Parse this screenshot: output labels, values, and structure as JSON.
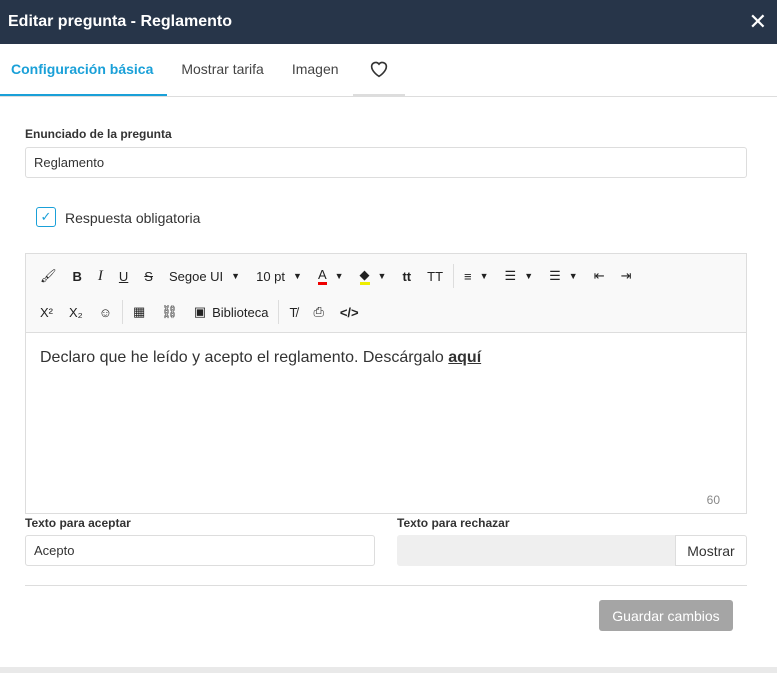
{
  "header": {
    "title": "Editar pregunta - Reglamento",
    "close": "✕"
  },
  "tabs": [
    "Configuración básica",
    "Mostrar tarifa",
    "Imagen"
  ],
  "question": {
    "label": "Enunciado de la pregunta",
    "value": "Reglamento"
  },
  "required": {
    "label": "Respuesta obligatoria",
    "checked": true
  },
  "toolbar": {
    "font": "Segoe UI",
    "size": "10 pt",
    "library": "Biblioteca"
  },
  "editor": {
    "text": "Declaro que he leído y acepto el reglamento. Descárgalo ",
    "link": "aquí",
    "count": "60"
  },
  "accept": {
    "label": "Texto para aceptar",
    "value": "Acepto"
  },
  "reject": {
    "label": "Texto para rechazar",
    "value": "",
    "button": "Mostrar"
  },
  "save": "Guardar cambios"
}
